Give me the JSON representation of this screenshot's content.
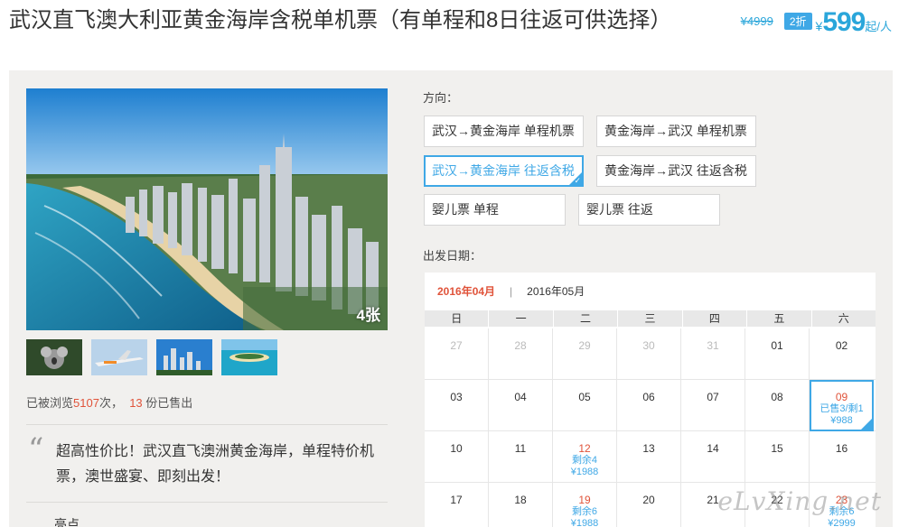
{
  "title": "武汉直飞澳大利亚黄金海岸含税单机票（有单程和8日往返可供选择）",
  "pricing": {
    "original": "¥4999",
    "discount": "2折",
    "currency": "¥",
    "price": "599",
    "unit": "起/人"
  },
  "gallery": {
    "count_label": "4张",
    "thumbnails": [
      "koala",
      "jetstar-plane",
      "city-skyline",
      "beach-island"
    ]
  },
  "stats": {
    "prefix": "已被浏览",
    "views": "5107",
    "mid": "次，",
    "sold": "13",
    "suffix": "份已售出"
  },
  "description": "超高性价比！武汉直飞澳洲黄金海岸，单程特价机票，澳世盛宴、即刻出发！",
  "highlight_label": "亮点",
  "direction": {
    "label": "方向：",
    "options": [
      "武汉→黄金海岸 单程机票",
      "黄金海岸→武汉 单程机票",
      "武汉→黄金海岸 往返含税",
      "黄金海岸→武汉 往返含税",
      "婴儿票 单程",
      "婴儿票 往返"
    ],
    "selected_index": 2
  },
  "date": {
    "label": "出发日期："
  },
  "calendar": {
    "month_active": "2016年04月",
    "separator": "|",
    "month_next": "2016年05月",
    "weekdays": [
      "日",
      "一",
      "二",
      "三",
      "四",
      "五",
      "六"
    ],
    "rows": [
      [
        {
          "day": "27",
          "dim": true
        },
        {
          "day": "28",
          "dim": true
        },
        {
          "day": "29",
          "dim": true
        },
        {
          "day": "30",
          "dim": true
        },
        {
          "day": "31",
          "dim": true
        },
        {
          "day": "01"
        },
        {
          "day": "02"
        }
      ],
      [
        {
          "day": "03"
        },
        {
          "day": "04"
        },
        {
          "day": "05"
        },
        {
          "day": "06"
        },
        {
          "day": "07"
        },
        {
          "day": "08"
        },
        {
          "day": "09",
          "red": true,
          "selected": true,
          "status": "已售3/剩1",
          "price": "¥988"
        }
      ],
      [
        {
          "day": "10"
        },
        {
          "day": "11"
        },
        {
          "day": "12",
          "red": true,
          "status": "剩余4",
          "price": "¥1988"
        },
        {
          "day": "13"
        },
        {
          "day": "14"
        },
        {
          "day": "15"
        },
        {
          "day": "16"
        }
      ],
      [
        {
          "day": "17"
        },
        {
          "day": "18"
        },
        {
          "day": "19",
          "red": true,
          "status": "剩余6",
          "price": "¥1988"
        },
        {
          "day": "20"
        },
        {
          "day": "21"
        },
        {
          "day": "22"
        },
        {
          "day": "23",
          "red": true,
          "status": "剩余6",
          "price": "¥2999"
        }
      ]
    ]
  },
  "watermark": "eLvXing.net",
  "colors": {
    "accent": "#3fa8e6",
    "price_red": "#e0533a",
    "panel_bg": "#f1f0ee"
  }
}
